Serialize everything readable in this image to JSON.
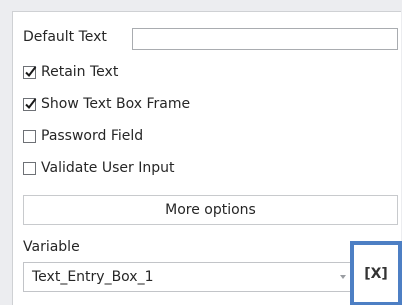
{
  "default_text": {
    "label": "Default Text",
    "value": ""
  },
  "options": [
    {
      "label": "Retain Text",
      "checked": true
    },
    {
      "label": "Show Text Box Frame",
      "checked": true
    },
    {
      "label": "Password Field",
      "checked": false
    },
    {
      "label": "Validate User Input",
      "checked": false
    }
  ],
  "more_options_label": "More options",
  "variable": {
    "label": "Variable",
    "selected": "Text_Entry_Box_1",
    "clear_label": "[X]"
  },
  "colors": {
    "highlight": "#4d7fc4",
    "background": "#ecedf0"
  }
}
